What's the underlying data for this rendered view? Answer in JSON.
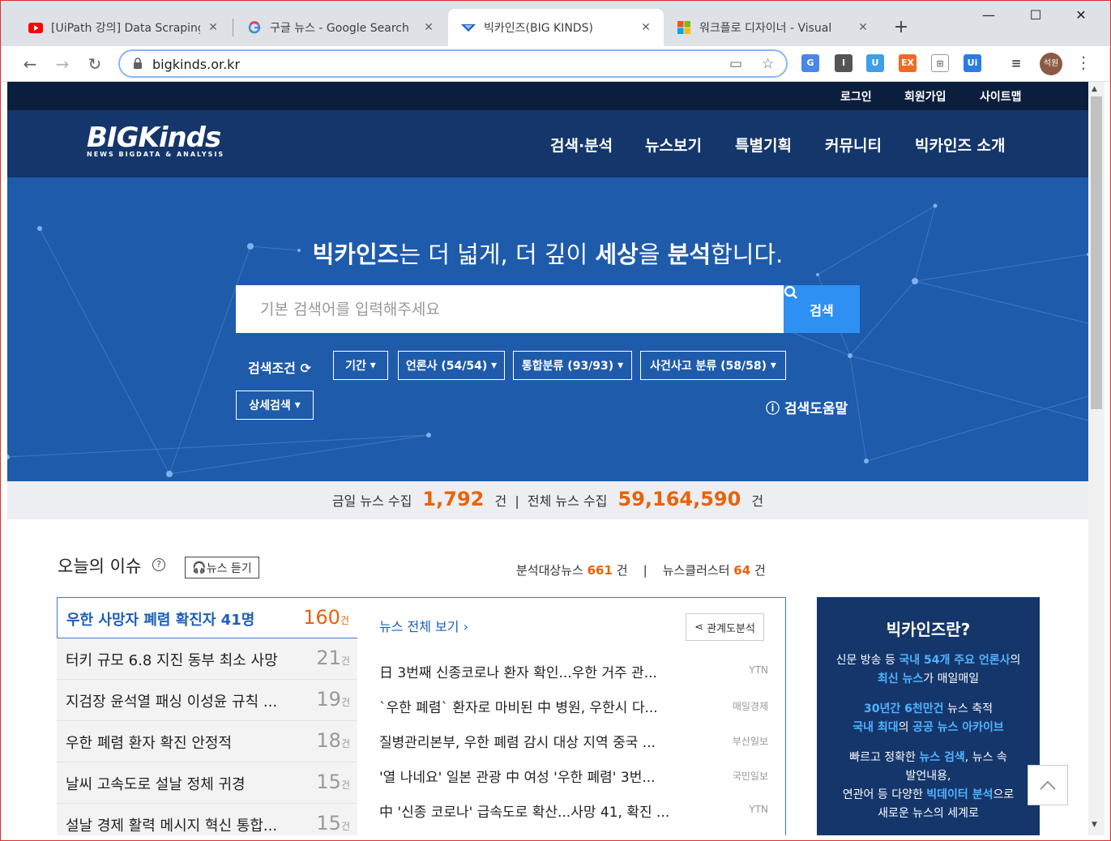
{
  "browser": {
    "tabs": [
      {
        "title": "[UiPath 강의] Data Scraping",
        "icon": "youtube-icon",
        "active": false
      },
      {
        "title": "구글 뉴스 - Google Search",
        "icon": "google-icon",
        "active": false
      },
      {
        "title": "빅카인즈(BIG KINDS)",
        "icon": "bigkinds-icon",
        "active": true
      },
      {
        "title": "워크플로 디자이너 - Visual",
        "icon": "microsoft-icon",
        "active": false
      }
    ],
    "new_tab": "+",
    "url": "bigkinds.or.kr",
    "profile_label": "석원",
    "extensions": [
      "translate-icon",
      "reader-icon",
      "shield-icon",
      "ex-icon",
      "grid-icon",
      "ui-icon",
      "playlist-icon"
    ],
    "extension_labels": {
      "ex": "EX",
      "ui": "Ui"
    }
  },
  "site": {
    "util_links": [
      "로그인",
      "회원가입",
      "사이트맵"
    ],
    "logo_text": "BIGKinds",
    "logo_sub": "NEWS BIGDATA & ANALYSIS",
    "nav": [
      "검색·분석",
      "뉴스보기",
      "특별기획",
      "커뮤니티",
      "빅카인즈 소개"
    ]
  },
  "hero": {
    "title_parts": [
      {
        "text": "빅카인즈",
        "bold": true
      },
      {
        "text": "는 더 넓게, 더 깊이 ",
        "bold": false
      },
      {
        "text": "세상",
        "bold": true
      },
      {
        "text": "을 ",
        "bold": false
      },
      {
        "text": "분석",
        "bold": true
      },
      {
        "text": "합니다.",
        "bold": false
      }
    ],
    "search_placeholder": "기본 검색어를 입력해주세요",
    "search_button": "검색",
    "condition_label": "검색조건",
    "filters": [
      "기간",
      "언론사 (54/54)",
      "통합분류 (93/93)",
      "사건사고 분류 (58/58)"
    ],
    "detail_search": "상세검색",
    "help_link": "검색도움말"
  },
  "stats": {
    "today_label": "금일 뉴스 수집",
    "today_value": "1,792",
    "unit": "건",
    "total_label": "전체 뉴스 수집",
    "total_value": "59,164,590"
  },
  "issues": {
    "heading": "오늘의 이슈",
    "listen_button": "뉴스 듣기",
    "analysis_label": "분석대상뉴스",
    "analysis_value": "661",
    "cluster_label": "뉴스클러스터",
    "cluster_value": "64",
    "unit": "건",
    "list": [
      {
        "title": "우한 사망자 폐렴 확진자 41명",
        "count": "160"
      },
      {
        "title": "터키 규모 6.8 지진 동부 최소 사망",
        "count": "21"
      },
      {
        "title": "지검장 윤석열 패싱 이성윤 규칙 ...",
        "count": "19"
      },
      {
        "title": "우한 폐렴 환자 확진 안정적",
        "count": "18"
      },
      {
        "title": "날씨 고속도로 설날 정체 귀경",
        "count": "15"
      },
      {
        "title": "설날 경제 활력 메시지 혁신 통합...",
        "count": "15"
      }
    ],
    "all_news_link": "뉴스 전체 보기",
    "relation_button": "관계도분석",
    "news": [
      {
        "headline": "日 3번째 신종코로나 환자 확인...우한 거주 관...",
        "source": "YTN"
      },
      {
        "headline": "`우한 폐렴` 환자로 마비된 中 병원, 우한시 다...",
        "source": "매일경제"
      },
      {
        "headline": "질병관리본부, 우한 폐렴 감시 대상 지역 중국 ...",
        "source": "부산일보"
      },
      {
        "headline": "'열 나네요' 일본 관광 中 여성 '우한 폐렴' 3번...",
        "source": "국민일보"
      },
      {
        "headline": "中 '신종 코로나' 급속도로 확산...사망 41, 확진 ...",
        "source": "YTN"
      }
    ]
  },
  "about": {
    "title": "빅카인즈란?",
    "line1_a": "신문 방송 등 ",
    "line1_b": "국내 54개 주요 언론사",
    "line1_c": "의",
    "line2_a": "최신 뉴스",
    "line2_b": "가 매일매일",
    "line3_a": "30년간 6천만건",
    "line3_b": " 뉴스 축적",
    "line4_a": "국내 최대",
    "line4_b": "의 ",
    "line4_c": "공공 뉴스 아카이브",
    "line5_a": "빠르고 정확한 ",
    "line5_b": "뉴스 검색",
    "line5_c": ", 뉴스 속",
    "line6": "발언내용,",
    "line7_a": "연관어 등 다양한 ",
    "line7_b": "빅데이터 분석",
    "line7_c": "으로",
    "line8": "새로운 뉴스의 세계로"
  }
}
